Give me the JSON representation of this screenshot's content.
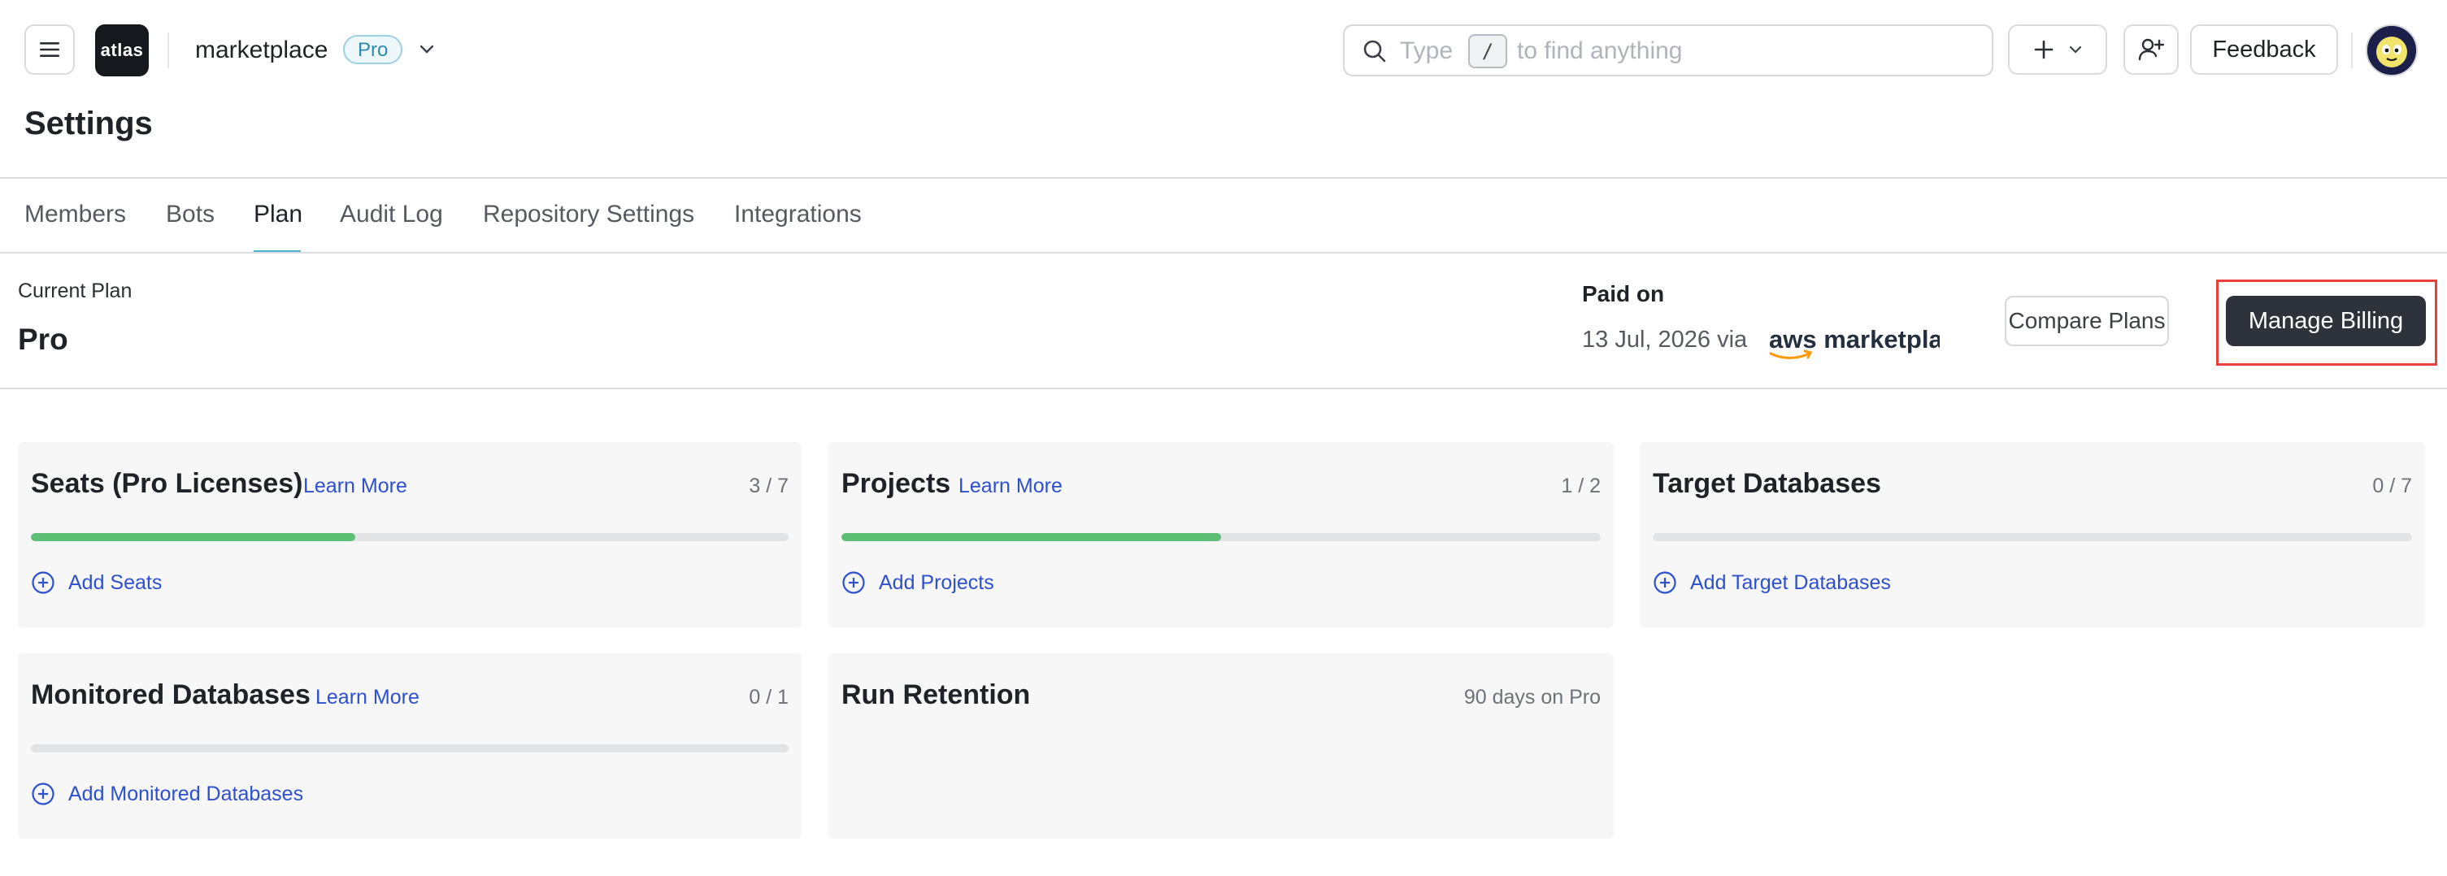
{
  "header": {
    "logo_text": "atlas",
    "workspace": "marketplace",
    "plan_badge": "Pro",
    "search": {
      "prefix": "Type",
      "shortcut": "/",
      "suffix": "to find anything"
    },
    "feedback_label": "Feedback"
  },
  "page_title": "Settings",
  "tabs": [
    {
      "label": "Members"
    },
    {
      "label": "Bots"
    },
    {
      "label": "Plan",
      "active": true
    },
    {
      "label": "Audit Log"
    },
    {
      "label": "Repository Settings"
    },
    {
      "label": "Integrations"
    }
  ],
  "plan": {
    "current_label": "Current Plan",
    "current_name": "Pro",
    "paid_label": "Paid on",
    "paid_date": "13 Jul, 2026 via",
    "vendor_logo": "aws marketplace",
    "compare_label": "Compare Plans",
    "manage_label": "Manage Billing"
  },
  "cards": [
    {
      "title": "Seats (Pro Licenses)",
      "learn": "Learn More",
      "count": "3 / 7",
      "progress": 0.4286,
      "add": "Add Seats"
    },
    {
      "title": "Projects",
      "learn": "Learn More",
      "count": "1 / 2",
      "progress": 0.5,
      "add": "Add Projects"
    },
    {
      "title": "Target Databases",
      "learn": "",
      "count": "0 / 7",
      "progress": 0,
      "add": "Add Target Databases"
    },
    {
      "title": "Monitored Databases",
      "learn": "Learn More",
      "count": "0 / 1",
      "progress": 0,
      "add": "Add Monitored Databases"
    },
    {
      "title": "Run Retention",
      "learn": "",
      "count": "90 days on Pro",
      "progress": null,
      "add": ""
    }
  ],
  "colors": {
    "accent_tab": "#4fb0d4",
    "progress_fill": "#5cbf73",
    "link": "#2c50cf",
    "primary_button": "#2e323b",
    "highlight_box": "#e8413a"
  }
}
